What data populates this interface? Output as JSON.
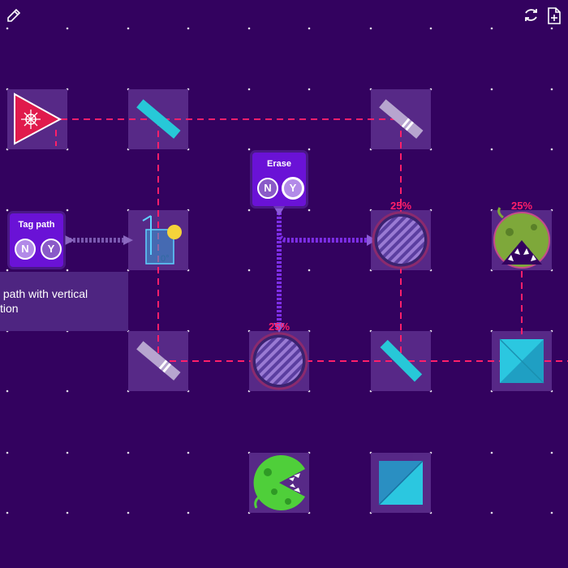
{
  "toolbar": {
    "edit_icon": "pencil-icon",
    "reset_icon": "refresh-icon",
    "export_icon": "file-plus-icon"
  },
  "gates": {
    "tag_path": {
      "title": "Tag path",
      "option_n": "N",
      "option_y": "Y",
      "selected": "N"
    },
    "erase": {
      "title": "Erase",
      "option_n": "N",
      "option_y": "Y",
      "selected": "Y"
    }
  },
  "tooltip": {
    "text": " path with vertical\ntion"
  },
  "glass": {
    "angle": "0°"
  },
  "detectors": {
    "top_right": {
      "percent": "25%"
    },
    "middle": {
      "percent": "25%"
    },
    "monster_top": {
      "percent": "25%"
    }
  },
  "colors": {
    "background": "#33025f",
    "laser": "#ff1f6a",
    "tile": "#5a2a8a",
    "gate": "#6a12d6",
    "mirror": "#27c8d8"
  }
}
